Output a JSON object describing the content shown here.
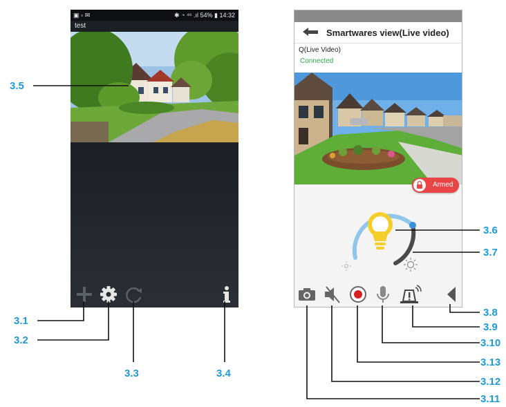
{
  "phone1": {
    "status_left": "▣ ▫ ✉",
    "status_right": "✱ ◔ ⁴⁶ .ıl 54% ▮ 14:32",
    "camera_title": "test",
    "icons": [
      "plus-icon",
      "gear-icon",
      "refresh-icon",
      "info-icon"
    ]
  },
  "phone2": {
    "title": "Smartwares view(Live video)",
    "camera_name": "Q(Live Video)",
    "connection_status": "Connected",
    "armed_label": "Armed",
    "brightness_level": 0.55,
    "icons": [
      "camera-icon",
      "mute-icon",
      "record-icon",
      "microphone-icon",
      "alarm-icon",
      "collapse-icon"
    ]
  },
  "colors": {
    "callout": "#1e9ad6",
    "armed": "#e84646",
    "connected": "#2ba84a",
    "arc": "#8fc6ea",
    "bulb": "#f4cf2c"
  },
  "callouts": {
    "c3_1": "3.1",
    "c3_2": "3.2",
    "c3_3": "3.3",
    "c3_4": "3.4",
    "c3_5": "3.5",
    "c3_6": "3.6",
    "c3_7": "3.7",
    "c3_8": "3.8",
    "c3_9": "3.9",
    "c3_10": "3.10",
    "c3_11": "3.11",
    "c3_12": "3.12",
    "c3_13": "3.13"
  }
}
